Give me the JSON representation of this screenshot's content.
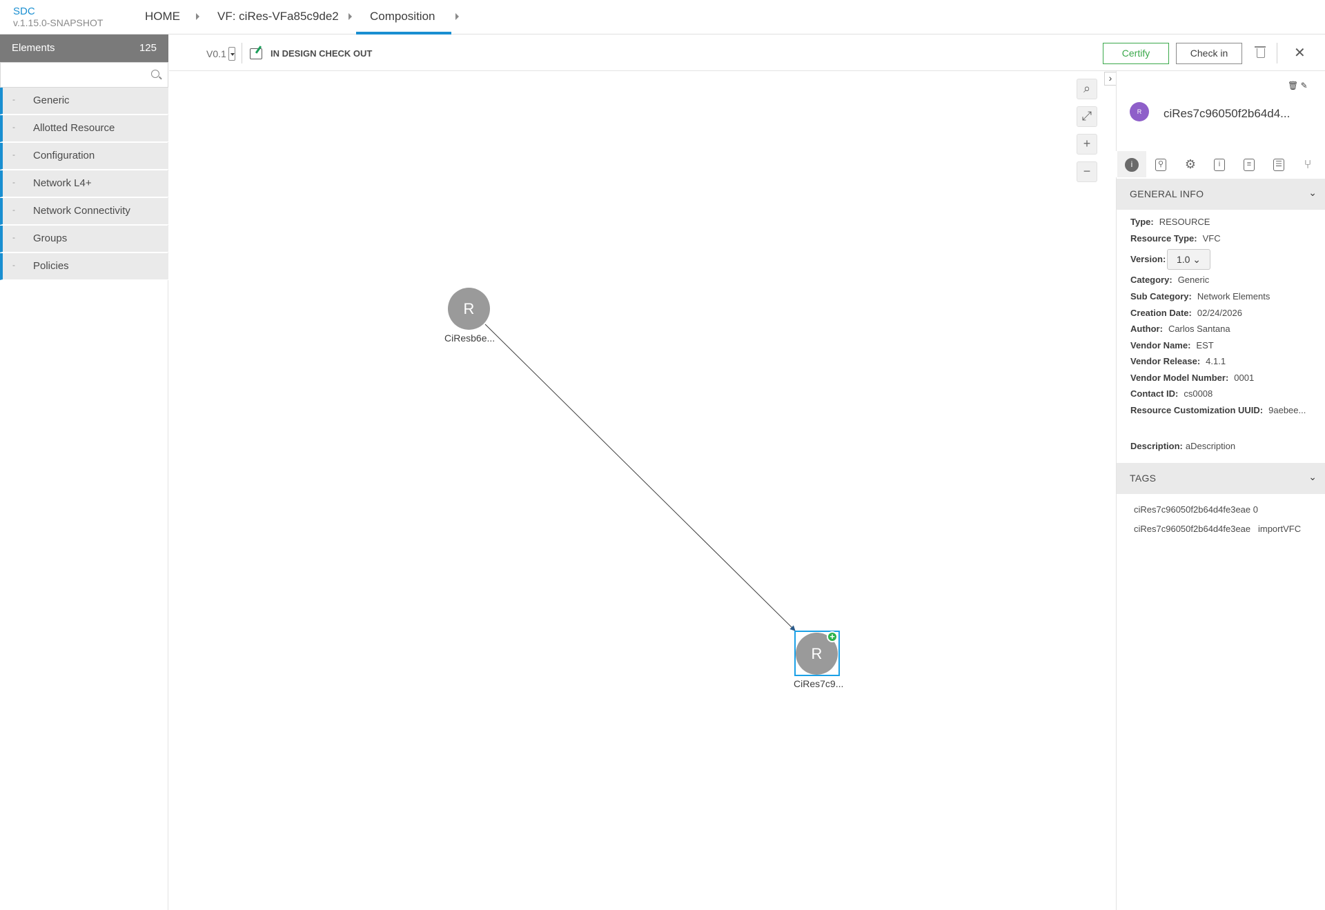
{
  "header": {
    "app_name": "SDC",
    "app_version": "v.1.15.0-SNAPSHOT",
    "breadcrumbs": [
      "HOME",
      "VF: ciRes-VFa85c9de2",
      "Composition"
    ]
  },
  "palette": {
    "title": "Elements",
    "count": "125",
    "search_placeholder": "",
    "categories": [
      "Generic",
      "Allotted Resource",
      "Configuration",
      "Network L4+",
      "Network Connectivity",
      "Groups",
      "Policies"
    ]
  },
  "toolbar": {
    "version": "V0.1",
    "status": "IN DESIGN CHECK OUT",
    "certify_label": "Certify",
    "checkin_label": "Check in",
    "close_glyph": "✕"
  },
  "zoom": {
    "search_glyph": "⌕",
    "fit_glyph": "⤢",
    "zoom_in_glyph": "+",
    "zoom_out_glyph": "−"
  },
  "graph": {
    "nodes": [
      {
        "letter": "R",
        "label": "CiResb6e..."
      },
      {
        "letter": "R",
        "label": "CiRes7c9..."
      }
    ],
    "add_badge": "+"
  },
  "right_panel": {
    "collapse_glyph": "›",
    "avatar_letter": "R",
    "title": "ciRes7c96050f2b64d4...",
    "general_info_title": "GENERAL INFO",
    "fields": {
      "type_label": "Type:",
      "type_value": "RESOURCE",
      "resource_type_label": "Resource Type:",
      "resource_type_value": "VFC",
      "version_label": "Version:",
      "version_value": "1.0 ⌄",
      "category_label": "Category:",
      "category_value": "Generic",
      "sub_category_label": "Sub Category:",
      "sub_category_value": "Network Elements",
      "creation_date_label": "Creation Date:",
      "creation_date_value": "02/24/2026",
      "author_label": "Author:",
      "author_value": "Carlos Santana",
      "vendor_name_label": "Vendor Name:",
      "vendor_name_value": "EST",
      "vendor_release_label": "Vendor Release:",
      "vendor_release_value": "4.1.1",
      "vendor_model_label": "Vendor Model Number:",
      "vendor_model_value": "0001",
      "contact_label": "Contact ID:",
      "contact_value": "cs0008",
      "uuid_label": "Resource Customization UUID:",
      "uuid_value": "9aebee...",
      "description_label": "Description:",
      "description_value": "aDescription"
    },
    "tags_title": "TAGS",
    "tags": [
      "ciRes7c96050f2b64d4fe3eae 0",
      "ciRes7c96050f2b64d4fe3eae   importVFC"
    ]
  }
}
